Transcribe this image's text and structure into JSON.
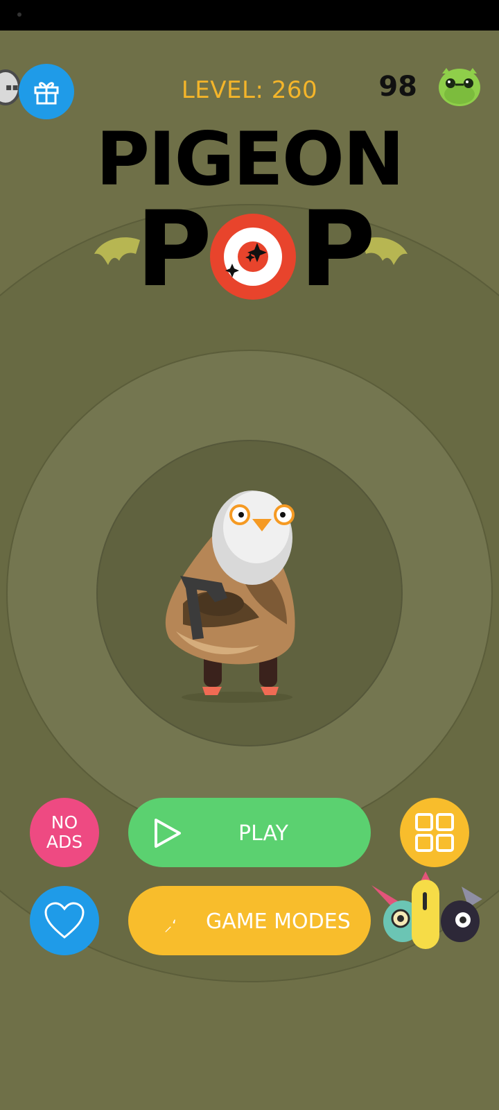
{
  "header": {
    "level_label": "LEVEL: 260",
    "currency_count": "98"
  },
  "title": {
    "line1": "PIGEON",
    "line2_left": "P",
    "line2_right": "P"
  },
  "buttons": {
    "no_ads": [
      "NO",
      "ADS"
    ],
    "play": "PLAY",
    "game_modes": "GAME MODES"
  },
  "icons": {
    "gift": "gift-icon",
    "currency": "green-monster-icon",
    "heart": "heart-icon",
    "grid": "grid-icon",
    "play": "play-icon"
  },
  "colors": {
    "background": "#6f7048",
    "level": "#f4b52a",
    "blue": "#1f9be8",
    "pink": "#ee4a82",
    "green": "#5bd170",
    "yellow": "#f8bd2c",
    "target_red": "#e8442c"
  }
}
